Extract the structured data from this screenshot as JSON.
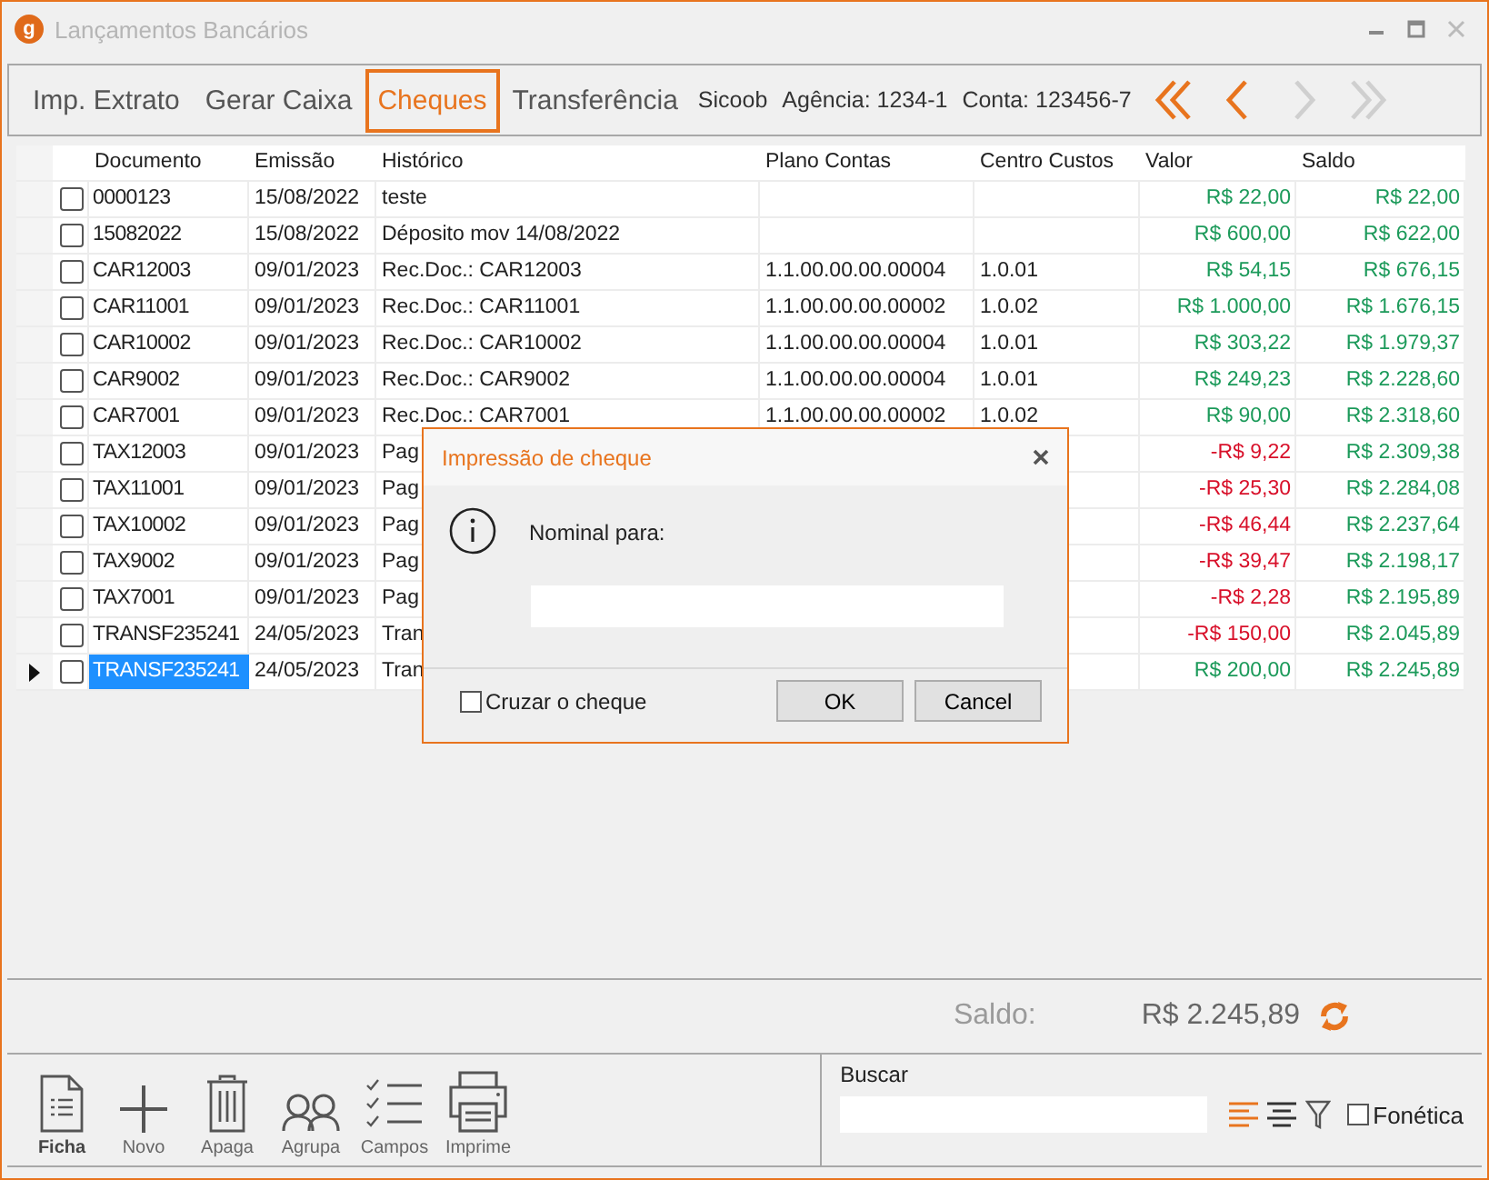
{
  "window": {
    "title": "Lançamentos Bancários",
    "logo": "g"
  },
  "toolbar": {
    "tabs": [
      {
        "label": "Imp. Extrato",
        "selected": false
      },
      {
        "label": "Gerar Caixa",
        "selected": false
      },
      {
        "label": "Cheques",
        "selected": true
      },
      {
        "label": "Transferência",
        "selected": false
      }
    ],
    "bank": "Sicoob",
    "agency": "Agência: 1234-1",
    "account": "Conta: 123456-7",
    "nav": [
      {
        "kind": "first",
        "disabled": false
      },
      {
        "kind": "prev",
        "disabled": false
      },
      {
        "kind": "next",
        "disabled": true
      },
      {
        "kind": "last",
        "disabled": true
      }
    ]
  },
  "table": {
    "columns": [
      "Documento",
      "Emissão",
      "Histórico",
      "Plano Contas",
      "Centro Custos",
      "Valor",
      "Saldo"
    ],
    "rows": [
      {
        "checked": false,
        "selected": false,
        "negative": false,
        "documento": "0000123",
        "emissao": "15/08/2022",
        "historico": "teste",
        "valor": "R$ 22,00",
        "saldo": "R$ 22,00"
      },
      {
        "checked": false,
        "selected": false,
        "negative": false,
        "documento": "15082022",
        "emissao": "15/08/2022",
        "historico": "Déposito mov 14/08/2022",
        "valor": "R$ 600,00",
        "saldo": "R$ 622,00"
      },
      {
        "checked": false,
        "selected": false,
        "negative": false,
        "documento": "CAR12003",
        "emissao": "09/01/2023",
        "historico": "Rec.Doc.: CAR12003",
        "plano": "1.1.00.00.00.00004",
        "centro": "1.0.01",
        "valor": "R$ 54,15",
        "saldo": "R$ 676,15"
      },
      {
        "checked": false,
        "selected": false,
        "negative": false,
        "documento": "CAR11001",
        "emissao": "09/01/2023",
        "historico": "Rec.Doc.: CAR11001",
        "plano": "1.1.00.00.00.00002",
        "centro": "1.0.02",
        "valor": "R$ 1.000,00",
        "saldo": "R$ 1.676,15"
      },
      {
        "checked": false,
        "selected": false,
        "negative": false,
        "documento": "CAR10002",
        "emissao": "09/01/2023",
        "historico": "Rec.Doc.: CAR10002",
        "plano": "1.1.00.00.00.00004",
        "centro": "1.0.01",
        "valor": "R$ 303,22",
        "saldo": "R$ 1.979,37"
      },
      {
        "checked": false,
        "selected": false,
        "negative": false,
        "documento": "CAR9002",
        "emissao": "09/01/2023",
        "historico": "Rec.Doc.: CAR9002",
        "plano": "1.1.00.00.00.00004",
        "centro": "1.0.01",
        "valor": "R$ 249,23",
        "saldo": "R$ 2.228,60"
      },
      {
        "checked": false,
        "selected": false,
        "negative": false,
        "documento": "CAR7001",
        "emissao": "09/01/2023",
        "historico": "Rec.Doc.: CAR7001",
        "plano": "1.1.00.00.00.00002",
        "centro": "1.0.02",
        "valor": "R$ 90,00",
        "saldo": "R$ 2.318,60"
      },
      {
        "checked": false,
        "selected": false,
        "negative": true,
        "documento": "TAX12003",
        "emissao": "09/01/2023",
        "historico": "Pag",
        "valor": "-R$ 9,22",
        "saldo": "R$ 2.309,38"
      },
      {
        "checked": false,
        "selected": false,
        "negative": true,
        "documento": "TAX11001",
        "emissao": "09/01/2023",
        "historico": "Pag",
        "valor": "-R$ 25,30",
        "saldo": "R$ 2.284,08"
      },
      {
        "checked": false,
        "selected": false,
        "negative": true,
        "documento": "TAX10002",
        "emissao": "09/01/2023",
        "historico": "Pag",
        "valor": "-R$ 46,44",
        "saldo": "R$ 2.237,64"
      },
      {
        "checked": false,
        "selected": false,
        "negative": true,
        "documento": "TAX9002",
        "emissao": "09/01/2023",
        "historico": "Pag",
        "valor": "-R$ 39,47",
        "saldo": "R$ 2.198,17"
      },
      {
        "checked": false,
        "selected": false,
        "negative": true,
        "documento": "TAX7001",
        "emissao": "09/01/2023",
        "historico": "Pag",
        "valor": "-R$ 2,28",
        "saldo": "R$ 2.195,89"
      },
      {
        "checked": false,
        "selected": false,
        "negative": true,
        "documento": "TRANSF235241",
        "emissao": "24/05/2023",
        "historico": "Tran",
        "valor": "-R$ 150,00",
        "saldo": "R$ 2.045,89"
      },
      {
        "checked": false,
        "selected": true,
        "negative": false,
        "documento": "TRANSF235241",
        "emissao": "24/05/2023",
        "historico": "Tran",
        "valor": "R$ 200,00",
        "saldo": "R$ 2.245,89"
      }
    ]
  },
  "dialog": {
    "title": "Impressão de cheque",
    "label": "Nominal para:",
    "cross": {
      "label": "Cruzar o cheque",
      "checked": false
    },
    "buttons": [
      "OK",
      "Cancel"
    ]
  },
  "footer": {
    "saldo_label": "Saldo:",
    "saldo_value": "R$ 2.245,89"
  },
  "actions": [
    {
      "kind": "ficha",
      "label": "Ficha"
    },
    {
      "kind": "novo",
      "label": "Novo"
    },
    {
      "kind": "apaga",
      "label": "Apaga"
    },
    {
      "kind": "agrupa",
      "label": "Agrupa"
    },
    {
      "kind": "campos",
      "label": "Campos"
    },
    {
      "kind": "imprime",
      "label": "Imprime"
    }
  ],
  "search": {
    "label": "Buscar",
    "options": [
      {
        "kind": "align-left",
        "selected": true
      },
      {
        "kind": "align-center",
        "selected": false
      },
      {
        "kind": "filter",
        "selected": false
      }
    ],
    "phonetic": {
      "label": "Fonética",
      "checked": false
    }
  }
}
